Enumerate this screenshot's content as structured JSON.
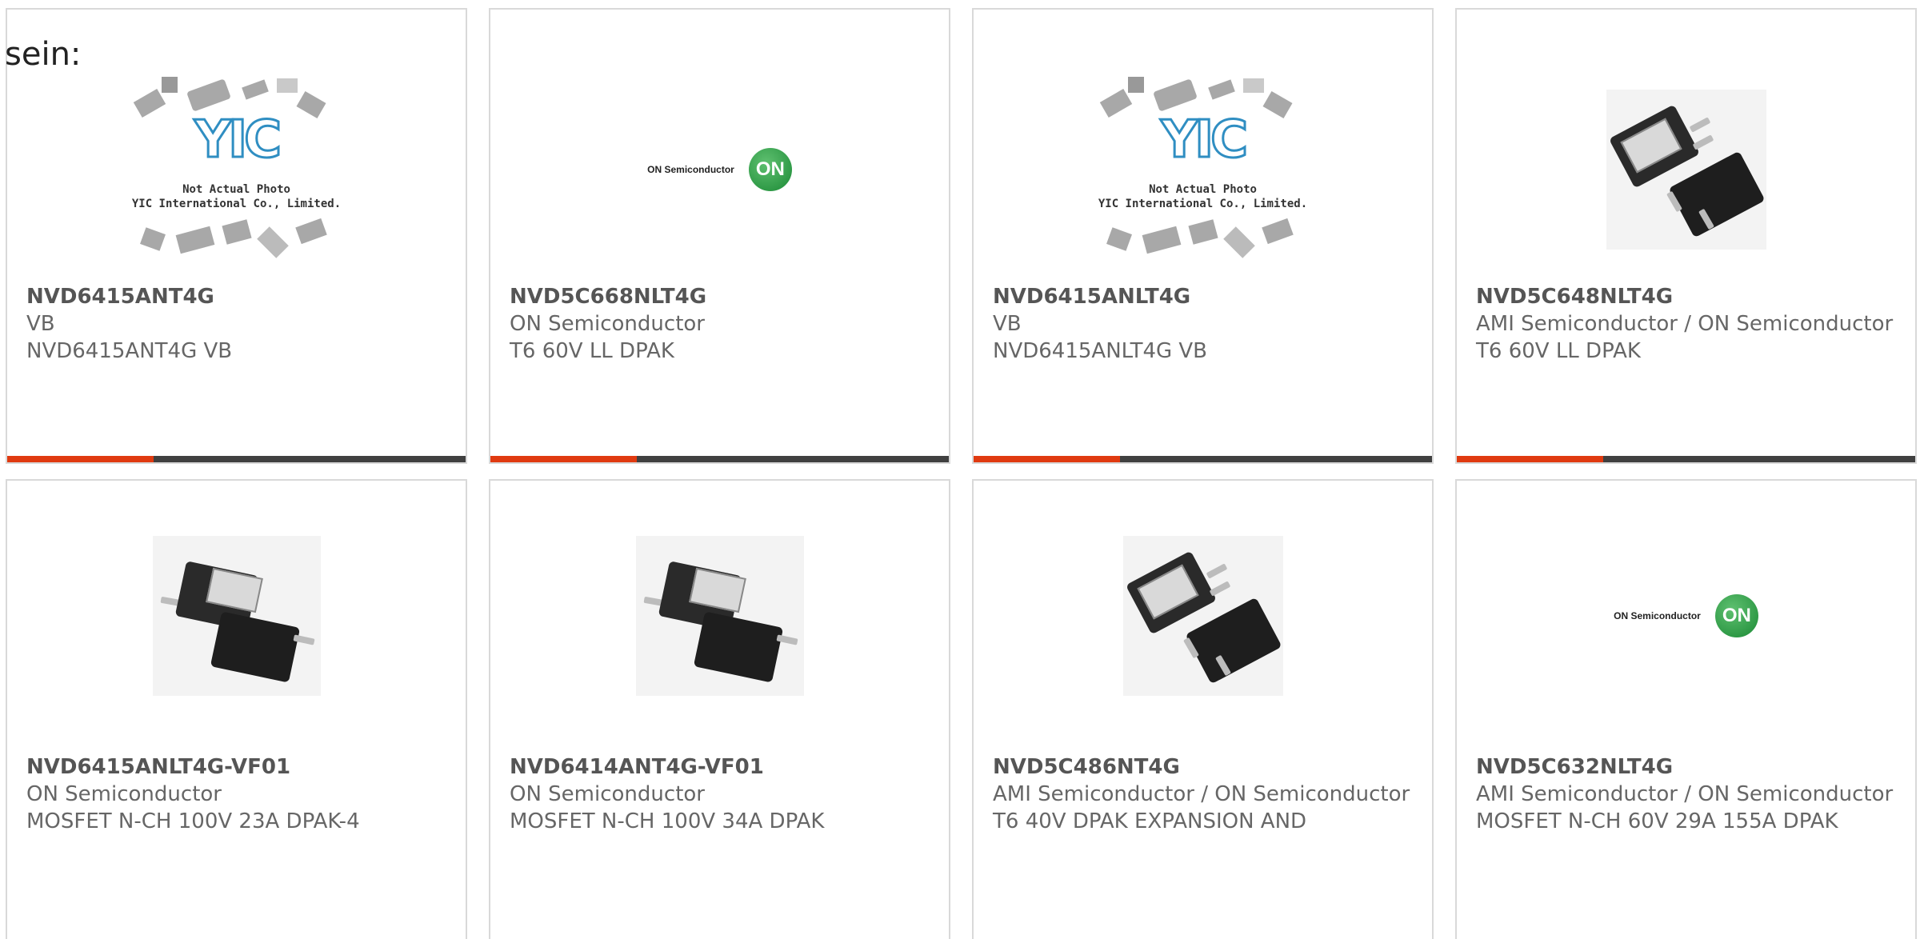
{
  "page": {
    "label": "sein:"
  },
  "products": [
    {
      "part": "NVD6415ANT4G",
      "manufacturer": "VB",
      "description": "NVD6415ANT4G VB",
      "image": "yic-not-actual-photo",
      "image_text": [
        "YIC",
        "Not Actual Photo",
        "YIC International Co., Limited."
      ]
    },
    {
      "part": "NVD5C668NLT4G",
      "manufacturer": "ON Semiconductor",
      "description": "T6 60V LL DPAK",
      "image": "on-semiconductor-logo",
      "image_text": [
        "ON Semiconductor",
        "ON"
      ]
    },
    {
      "part": "NVD6415ANLT4G",
      "manufacturer": "VB",
      "description": "NVD6415ANLT4G VB",
      "image": "yic-not-actual-photo",
      "image_text": [
        "YIC",
        "Not Actual Photo",
        "YIC International Co., Limited."
      ]
    },
    {
      "part": "NVD5C648NLT4G",
      "manufacturer": "AMI Semiconductor / ON Semiconductor",
      "description": "T6 60V LL DPAK",
      "image": "dpak-package-photo"
    },
    {
      "part": "NVD6415ANLT4G-VF01",
      "manufacturer": "ON Semiconductor",
      "description": "MOSFET N-CH 100V 23A DPAK-4",
      "image": "dpak-package-photo"
    },
    {
      "part": "NVD6414ANT4G-VF01",
      "manufacturer": "ON Semiconductor",
      "description": "MOSFET N-CH 100V 34A DPAK",
      "image": "dpak-package-photo"
    },
    {
      "part": "NVD5C486NT4G",
      "manufacturer": "AMI Semiconductor / ON Semiconductor",
      "description": "T6 40V DPAK EXPANSION AND",
      "image": "dpak-package-photo"
    },
    {
      "part": "NVD5C632NLT4G",
      "manufacturer": "AMI Semiconductor / ON Semiconductor",
      "description": "MOSFET N-CH 60V 29A 155A DPAK",
      "image": "on-semiconductor-logo",
      "image_text": [
        "ON Semiconductor",
        "ON"
      ]
    }
  ],
  "colors": {
    "accent": "#e03a10",
    "bar": "#404040",
    "border": "#d9d9d9"
  }
}
